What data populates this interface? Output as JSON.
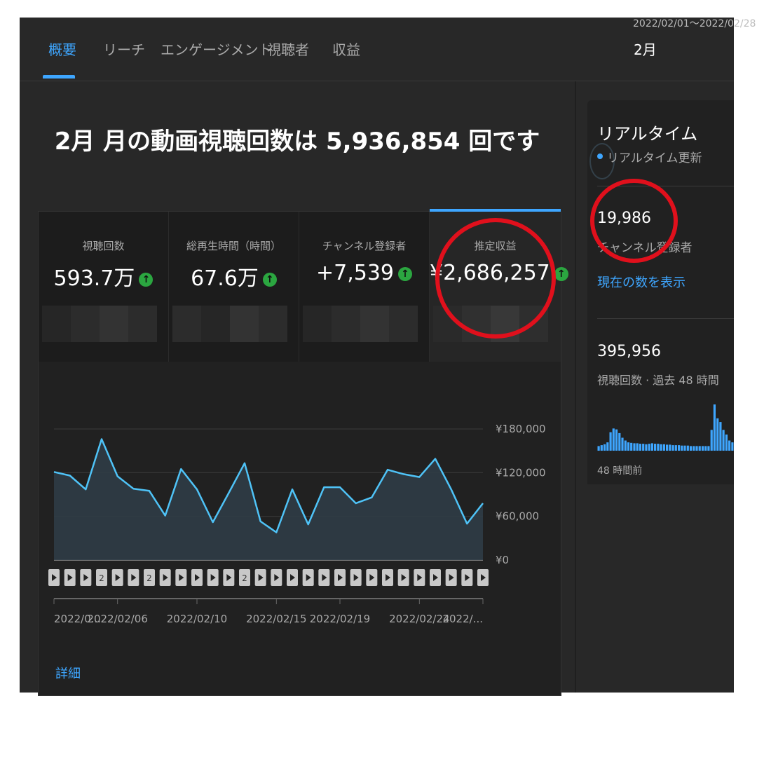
{
  "tabs": [
    {
      "label": "概要",
      "active": true
    },
    {
      "label": "リーチ",
      "active": false
    },
    {
      "label": "エンゲージメント",
      "active": false
    },
    {
      "label": "視聴者",
      "active": false
    },
    {
      "label": "収益",
      "active": false
    }
  ],
  "date_picker": {
    "range": "2022/02/01〜2022/02/28",
    "label": "2月"
  },
  "headline": "2月 月の動画視聴回数は 5,936,854 回です",
  "kpis": [
    {
      "label": "視聴回数",
      "value": "593.7万"
    },
    {
      "label": "総再生時間（時間）",
      "value": "67.6万"
    },
    {
      "label": "チャンネル登録者",
      "value": "+7,539"
    },
    {
      "label": "推定収益",
      "value": "¥2,686,257",
      "selected": true
    }
  ],
  "detail_link": "詳細",
  "chart_data": {
    "type": "area",
    "y_tick_labels": [
      "¥180,000",
      "¥120,000",
      "¥60,000",
      "¥0"
    ],
    "ylim": [
      0,
      180000
    ],
    "x_tick_labels": [
      "2022/0...",
      "2022/02/06",
      "2022/02/10",
      "2022/02/15",
      "2022/02/19",
      "2022/02/24",
      "2022/..."
    ],
    "x": [
      1,
      2,
      3,
      4,
      5,
      6,
      7,
      8,
      9,
      10,
      11,
      12,
      13,
      14,
      15,
      16,
      17,
      18,
      19,
      20,
      21,
      22,
      23,
      24,
      25,
      26,
      27,
      28
    ],
    "values": [
      121000,
      116000,
      97000,
      166000,
      115000,
      98000,
      95000,
      61000,
      125000,
      97000,
      52000,
      92000,
      133000,
      53000,
      38000,
      97000,
      49000,
      100000,
      100000,
      78000,
      86000,
      124000,
      118000,
      114000,
      139000,
      97000,
      50000,
      78000
    ],
    "grid": true,
    "video_markers": [
      "",
      "",
      "",
      "2",
      "",
      "",
      "2",
      "",
      "",
      "",
      "",
      "",
      "2",
      "",
      "",
      "",
      "",
      "",
      "",
      "",
      "",
      "",
      "",
      "",
      "",
      "",
      "",
      ""
    ],
    "line_color": "#4fc3f7"
  },
  "realtime": {
    "title": "リアルタイム",
    "update_label": "リアルタイム更新",
    "subscribers": "19,986",
    "subscribers_label": "チャンネル登録者",
    "show_link": "現在の数を表示",
    "views": "395,956",
    "views_label": "視聴回数 · 過去 48 時間",
    "ago_label": "48 時間前",
    "bars": [
      0.1,
      0.12,
      0.14,
      0.18,
      0.4,
      0.48,
      0.46,
      0.38,
      0.28,
      0.22,
      0.18,
      0.17,
      0.16,
      0.16,
      0.15,
      0.15,
      0.14,
      0.15,
      0.16,
      0.15,
      0.15,
      0.14,
      0.14,
      0.13,
      0.13,
      0.12,
      0.12,
      0.12,
      0.11,
      0.11,
      0.11,
      0.1,
      0.1,
      0.1,
      0.1,
      0.1,
      0.1,
      0.1,
      0.45,
      1.0,
      0.7,
      0.62,
      0.45,
      0.35,
      0.22,
      0.18
    ]
  },
  "colors": {
    "accent": "#3ea6ff",
    "background": "#282828",
    "annotation": "#e0101c"
  }
}
